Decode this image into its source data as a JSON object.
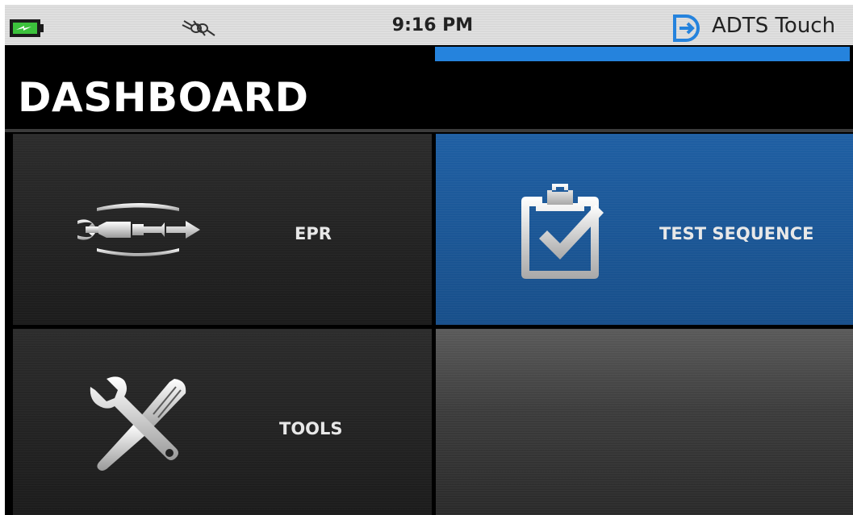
{
  "status_bar": {
    "battery_icon": "battery-charging-icon",
    "connection_icon": "plug-disconnected-icon",
    "time": "9:16 PM",
    "brand_icon": "brand-logo-icon",
    "brand_name": "ADTS Touch",
    "progress_percent": 100,
    "accent_color": "#2583dd"
  },
  "header": {
    "title": "DASHBOARD"
  },
  "tiles": [
    {
      "label": "EPR",
      "icon": "epr-engine-icon"
    },
    {
      "label": "TEST SEQUENCE",
      "icon": "clipboard-check-icon",
      "color": "#1f5fa3"
    },
    {
      "label": "TOOLS",
      "icon": "tools-icon"
    }
  ]
}
